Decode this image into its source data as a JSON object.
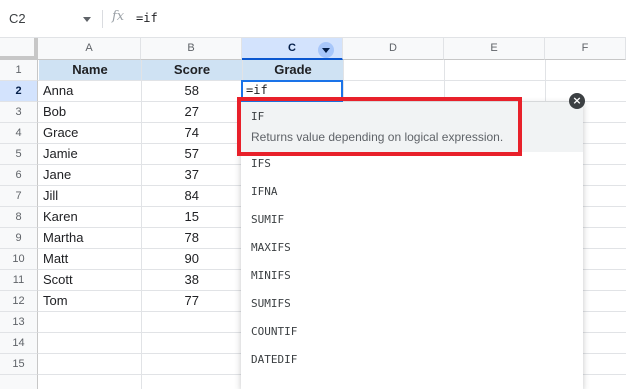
{
  "formula_bar": {
    "cell_ref": "C2",
    "fx_icon": "fx-icon",
    "value": "=if"
  },
  "columns": [
    "A",
    "B",
    "C",
    "D",
    "E",
    "F"
  ],
  "selected_column": "C",
  "rows": [
    "1",
    "2",
    "3",
    "4",
    "5",
    "6",
    "7",
    "8",
    "9",
    "10",
    "11",
    "12",
    "13",
    "14",
    "15"
  ],
  "selected_row": "2",
  "table": {
    "headers": [
      "Name",
      "Score",
      "Grade"
    ],
    "records": [
      {
        "name": "Anna",
        "score": "58"
      },
      {
        "name": "Bob",
        "score": "27"
      },
      {
        "name": "Grace",
        "score": "74"
      },
      {
        "name": "Jamie",
        "score": "57"
      },
      {
        "name": "Jane",
        "score": "37"
      },
      {
        "name": "Jill",
        "score": "84"
      },
      {
        "name": "Karen",
        "score": "15"
      },
      {
        "name": "Martha",
        "score": "78"
      },
      {
        "name": "Matt",
        "score": "90"
      },
      {
        "name": "Scott",
        "score": "38"
      },
      {
        "name": "Tom",
        "score": "77"
      }
    ]
  },
  "active_cell": {
    "ref": "C2",
    "value": "=if"
  },
  "autocomplete": {
    "first": {
      "name": "IF",
      "description": "Returns value depending on logical expression."
    },
    "items": [
      "IFS",
      "IFNA",
      "SUMIF",
      "MAXIFS",
      "MINIFS",
      "SUMIFS",
      "COUNTIF",
      "DATEDIF"
    ],
    "close_icon": "close-icon",
    "highlight_color": "#e8202a"
  },
  "colors": {
    "header_fill": "#cfe2f3",
    "selection_blue": "#1a73e8"
  }
}
